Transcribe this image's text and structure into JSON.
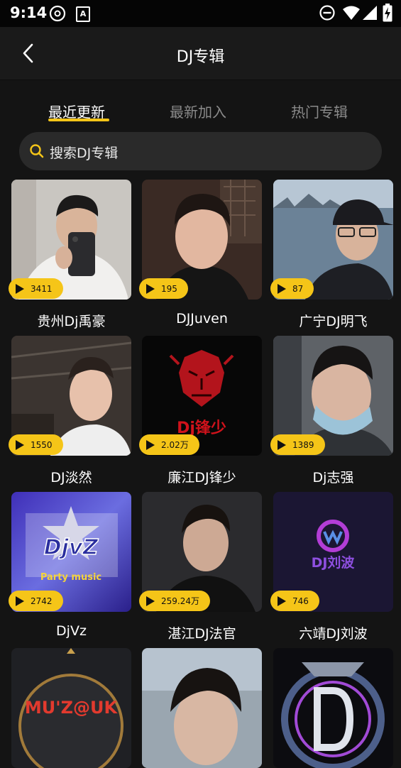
{
  "status_bar": {
    "time": "9:14",
    "aa_label": "A"
  },
  "header": {
    "title": "DJ专辑"
  },
  "tabs": [
    {
      "label": "最近更新",
      "active": true
    },
    {
      "label": "最新加入",
      "active": false
    },
    {
      "label": "热门专辑",
      "active": false
    }
  ],
  "search": {
    "placeholder": "搜索DJ专辑"
  },
  "albums": [
    {
      "name": "贵州Dj禹豪",
      "plays": "3411"
    },
    {
      "name": "DJJuven",
      "plays": "195"
    },
    {
      "name": "广宁DJ明飞",
      "plays": "87"
    },
    {
      "name": "DJ淡然",
      "plays": "1550"
    },
    {
      "name": "廉江DJ锋少",
      "plays": "2.02万",
      "cover_text": "Dj锋少"
    },
    {
      "name": "Dj志强",
      "plays": "1389"
    },
    {
      "name": "DjVz",
      "plays": "2742",
      "cover_text": "DjvZ",
      "cover_subtext": "Party music"
    },
    {
      "name": "湛江DJ法官",
      "plays": "259.24万"
    },
    {
      "name": "六靖DJ刘波",
      "plays": "746",
      "cover_text": "DJ刘波"
    },
    {
      "name": "",
      "plays": "",
      "cover_text": "MU'Z@UK"
    },
    {
      "name": "",
      "plays": ""
    },
    {
      "name": "",
      "plays": ""
    }
  ],
  "colors": {
    "accent": "#f5c518",
    "background": "#141414",
    "header": "#1a1a1a"
  },
  "icons": {
    "back": "chevron-left-icon",
    "search": "search-icon",
    "play": "play-icon"
  }
}
